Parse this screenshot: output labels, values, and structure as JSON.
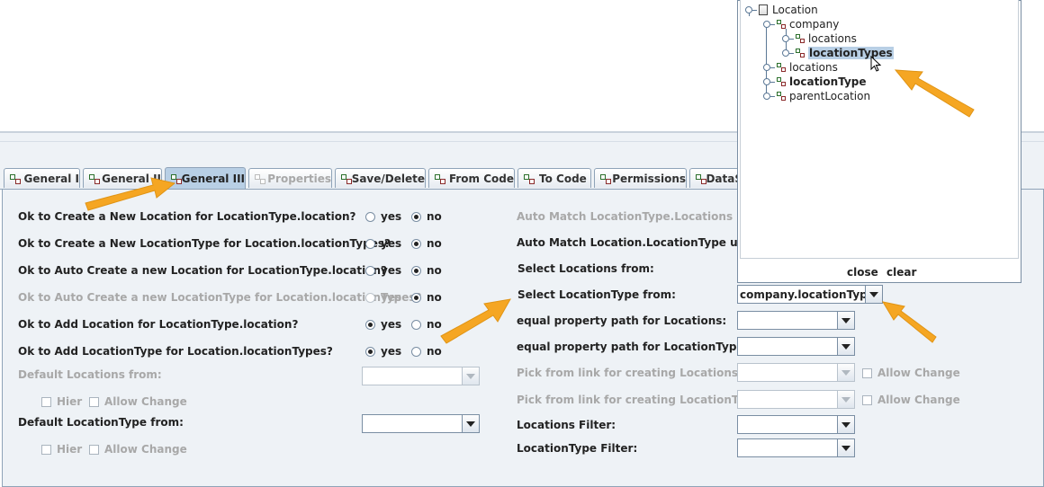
{
  "tabs": [
    {
      "label": "General I",
      "state": "normal"
    },
    {
      "label": "General II",
      "state": "normal"
    },
    {
      "label": "General III",
      "state": "active"
    },
    {
      "label": "Properties",
      "state": "disabled"
    },
    {
      "label": "Save/Delete",
      "state": "normal"
    },
    {
      "label": "From Code",
      "state": "normal"
    },
    {
      "label": "To Code",
      "state": "normal"
    },
    {
      "label": "Permissions",
      "state": "normal"
    },
    {
      "label": "DataS",
      "state": "normal"
    }
  ],
  "left": {
    "rows": [
      {
        "label": "Ok to Create a New Location for LocationType.location?",
        "selected": "no",
        "disabled": false
      },
      {
        "label": "Ok to Create a New LocationType for Location.locationTypes?",
        "selected": "no",
        "disabled": false
      },
      {
        "label": "Ok to Auto Create a new Location for LocationType.location?",
        "selected": "no",
        "disabled": false
      },
      {
        "label": "Ok to Auto Create a new LocationType for Location.locationTypes?",
        "selected": "no",
        "disabled": true
      },
      {
        "label": "Ok to Add Location for LocationType.location?",
        "selected": "yes",
        "disabled": false
      },
      {
        "label": "Ok to Add LocationType for Location.locationTypes?",
        "selected": "yes",
        "disabled": false
      }
    ],
    "yes_label": "yes",
    "no_label": "no",
    "default_locations_label": "Default Locations from:",
    "default_locationtype_label": "Default LocationType from:",
    "hier_label": "Hier",
    "allow_change_label": "Allow Change"
  },
  "right": {
    "auto_match_locations": "Auto Match LocationType.Locations using:",
    "auto_match_locationtype": "Auto Match Location.LocationType using:",
    "select_locations": "Select Locations from:",
    "select_locationtype": "Select LocationType from:",
    "select_locationtype_value": "company.locationTypes",
    "equal_locations": "equal property path for Locations:",
    "equal_locationtype": "equal property path for LocationType:",
    "pick_locations": "Pick from link for creating Locations:",
    "pick_locationtype": "Pick from link for creating LocationType:",
    "allow_change_label": "Allow Change",
    "locations_filter": "Locations Filter:",
    "locationtype_filter": "LocationType Filter:"
  },
  "tree_popup": {
    "root": "Location",
    "company": "company",
    "company_locations": "locations",
    "company_locationTypes": "locationTypes",
    "locations": "locations",
    "locationType": "locationType",
    "parentLocation": "parentLocation",
    "close_label": "close",
    "clear_label": "clear"
  },
  "annotation_color": "#f5a623"
}
